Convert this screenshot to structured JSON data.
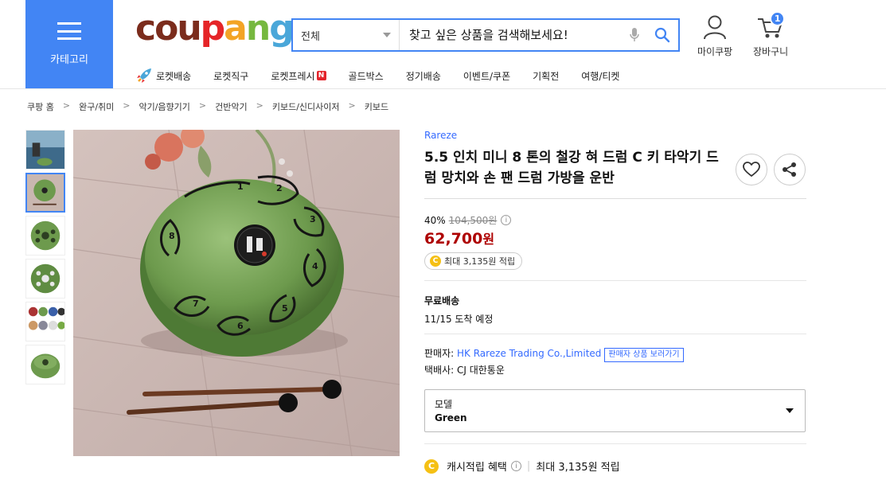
{
  "header": {
    "category_label": "카테고리",
    "logo": {
      "letters": [
        "c",
        "o",
        "u",
        "p",
        "a",
        "n",
        "g"
      ],
      "colors": [
        "#7b2c1c",
        "#7b2c1c",
        "#7b2c1c",
        "#e52528",
        "#f3a425",
        "#76b83f",
        "#4aa7d9"
      ]
    },
    "search": {
      "category": "전체",
      "placeholder": "찾고 싶은 상품을 검색해보세요!"
    },
    "mycoupang_label": "마이쿠팡",
    "cart_label": "장바구니",
    "cart_count": "1"
  },
  "nav": [
    "로켓배송",
    "로켓직구",
    "로켓프레시",
    "골드박스",
    "정기배송",
    "이벤트/쿠폰",
    "기획전",
    "여행/티켓"
  ],
  "nav_badge": "N",
  "breadcrumb": [
    "쿠팡 홈",
    "완구/취미",
    "악기/음향기기",
    "건반악기",
    "키보드/신디사이저",
    "키보드"
  ],
  "breadcrumb_sep": ">",
  "product": {
    "brand": "Rareze",
    "title": "5.5 인치 미니 8 톤의 철강 혀 드럼 C 키 타악기 드럼 망치와 손 팬 드럼 가방을 운반",
    "discount": "40%",
    "original_price": "104,500원",
    "sale_price": "62,700",
    "sale_unit": "원",
    "reward": "최대 3,135원 적립",
    "shipping_type": "무료배송",
    "eta": "11/15 도착 예정",
    "seller_label": "판매자: ",
    "seller_name": "HK Rareze Trading Co.,Limited",
    "seller_button": "판매자 상품 보러가기",
    "courier": "택배사: CJ 대한통운",
    "option_label": "모델",
    "option_value": "Green",
    "cash_label": "캐시적립 혜택",
    "cash_value": "최대 3,135원 적립"
  },
  "colors": {
    "accent": "#4285f4",
    "price": "#ae0000",
    "link": "#346aff",
    "drum": "#6d9a4d"
  },
  "drum_notes": [
    "1",
    "2",
    "3",
    "4",
    "5",
    "6",
    "7",
    "8"
  ]
}
